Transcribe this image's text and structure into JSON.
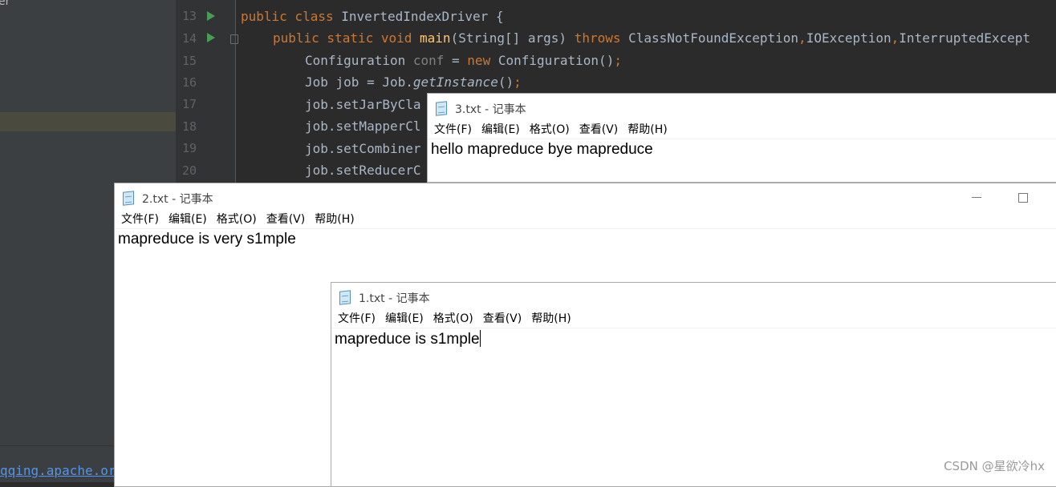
{
  "ide": {
    "sidebar_fragment": "er",
    "status_link": "qqing.apache.or",
    "line_numbers": [
      "13",
      "14",
      "15",
      "16",
      "17",
      "18",
      "19",
      "20"
    ],
    "code": {
      "l13": {
        "kw": "public class ",
        "rest": "InvertedIndexDriver {"
      },
      "l14": {
        "kw": "public static void ",
        "fn": "main",
        "args": "(String[] args) ",
        "throws": "throws ",
        "ex1": "ClassNotFoundException",
        "comma1": ",",
        "ex2": "IOException",
        "comma2": ",",
        "ex3": "InterruptedExcept"
      },
      "l15": {
        "a": "Configuration ",
        "conf": "conf",
        "b": " = ",
        "new": "new ",
        "c": "Configuration()",
        "semi": ";"
      },
      "l16": {
        "a": "Job job = Job.",
        "getinst": "getInstance",
        "b": "()",
        "semi": ";"
      },
      "l17": "job.setJarByCla",
      "l18": "job.setMapperCl",
      "l19": "job.setCombiner",
      "l20": "job.setReducerC"
    }
  },
  "notepads": [
    {
      "title": "3.txt - 记事本",
      "content": "hello mapreduce bye mapreduce"
    },
    {
      "title": "2.txt - 记事本",
      "content": "mapreduce is very s1mple"
    },
    {
      "title": "1.txt - 记事本",
      "content": "mapreduce is s1mple"
    }
  ],
  "menu": [
    "文件(F)",
    "编辑(E)",
    "格式(O)",
    "查看(V)",
    "帮助(H)"
  ],
  "watermark": "CSDN @星欲冷hx"
}
